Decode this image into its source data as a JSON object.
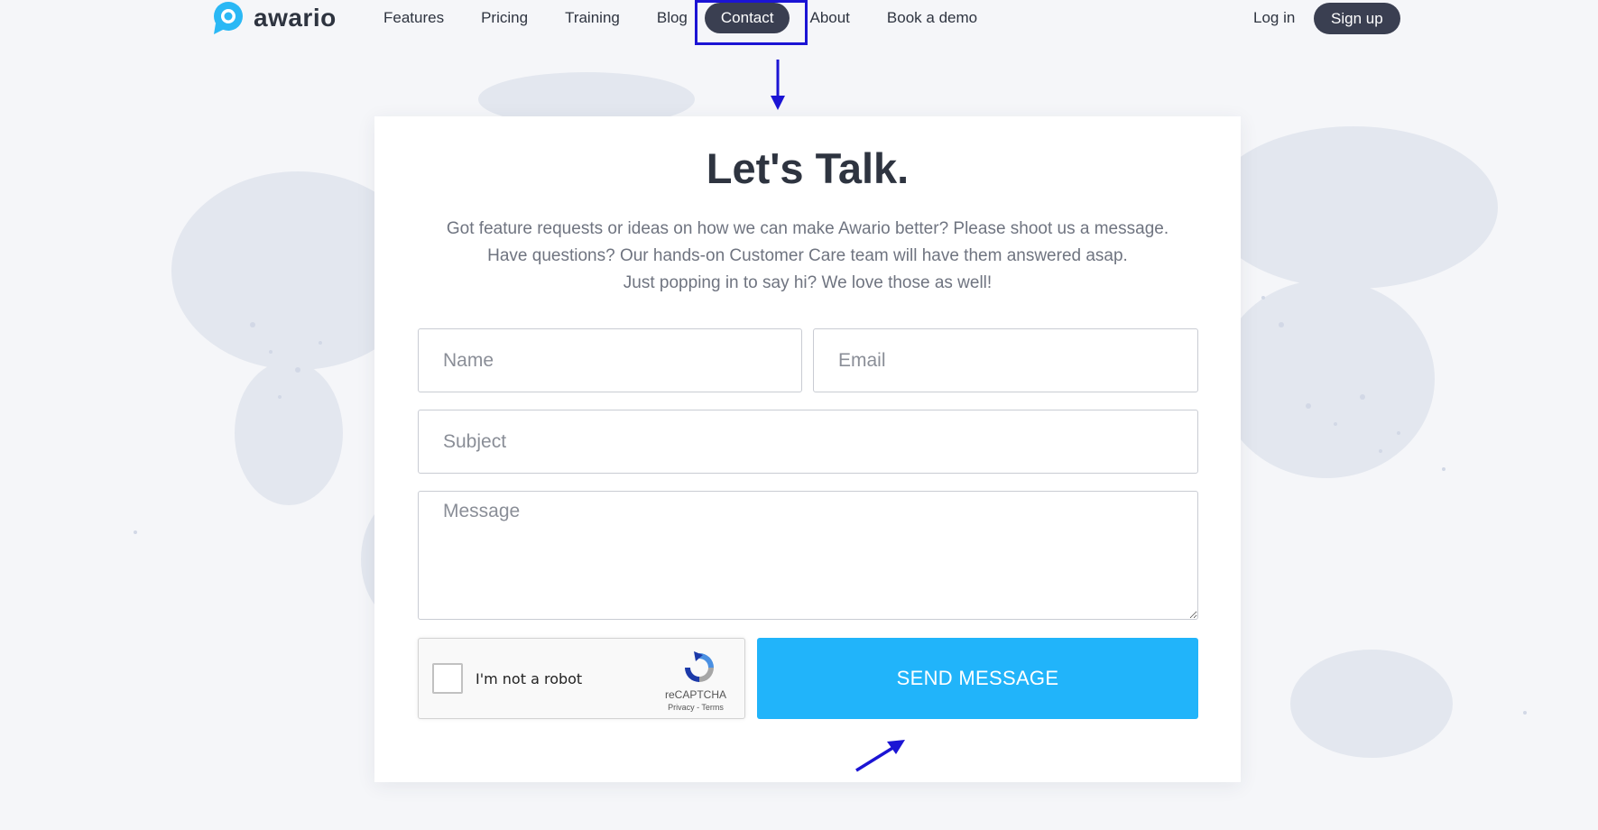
{
  "brand": {
    "name": "awario",
    "color": "#2ab8f5"
  },
  "nav": {
    "items": [
      {
        "label": "Features",
        "active": false
      },
      {
        "label": "Pricing",
        "active": false
      },
      {
        "label": "Training",
        "active": false
      },
      {
        "label": "Blog",
        "active": false
      },
      {
        "label": "Contact",
        "active": true
      },
      {
        "label": "About",
        "active": false
      },
      {
        "label": "Book a demo",
        "active": false
      }
    ],
    "login": "Log in",
    "signup": "Sign up"
  },
  "contact": {
    "title": "Let's Talk.",
    "intro": [
      "Got feature requests or ideas on how we can make Awario better? Please shoot us a message.",
      "Have questions? Our hands-on Customer Care team will have them answered asap.",
      "Just popping in to say hi? We love those as well!"
    ],
    "fields": {
      "name_placeholder": "Name",
      "email_placeholder": "Email",
      "subject_placeholder": "Subject",
      "message_placeholder": "Message"
    },
    "captcha": {
      "label": "I'm not a robot",
      "brand": "reCAPTCHA",
      "links": "Privacy - Terms"
    },
    "send_label": "SEND MESSAGE"
  },
  "colors": {
    "accent": "#21b4fa",
    "dark": "#3a3f51",
    "annotation": "#1b14d4"
  },
  "annotations": {
    "highlight_target": "Contact",
    "arrow_icons": [
      "arrow-down-icon",
      "arrow-up-right-icon"
    ]
  }
}
